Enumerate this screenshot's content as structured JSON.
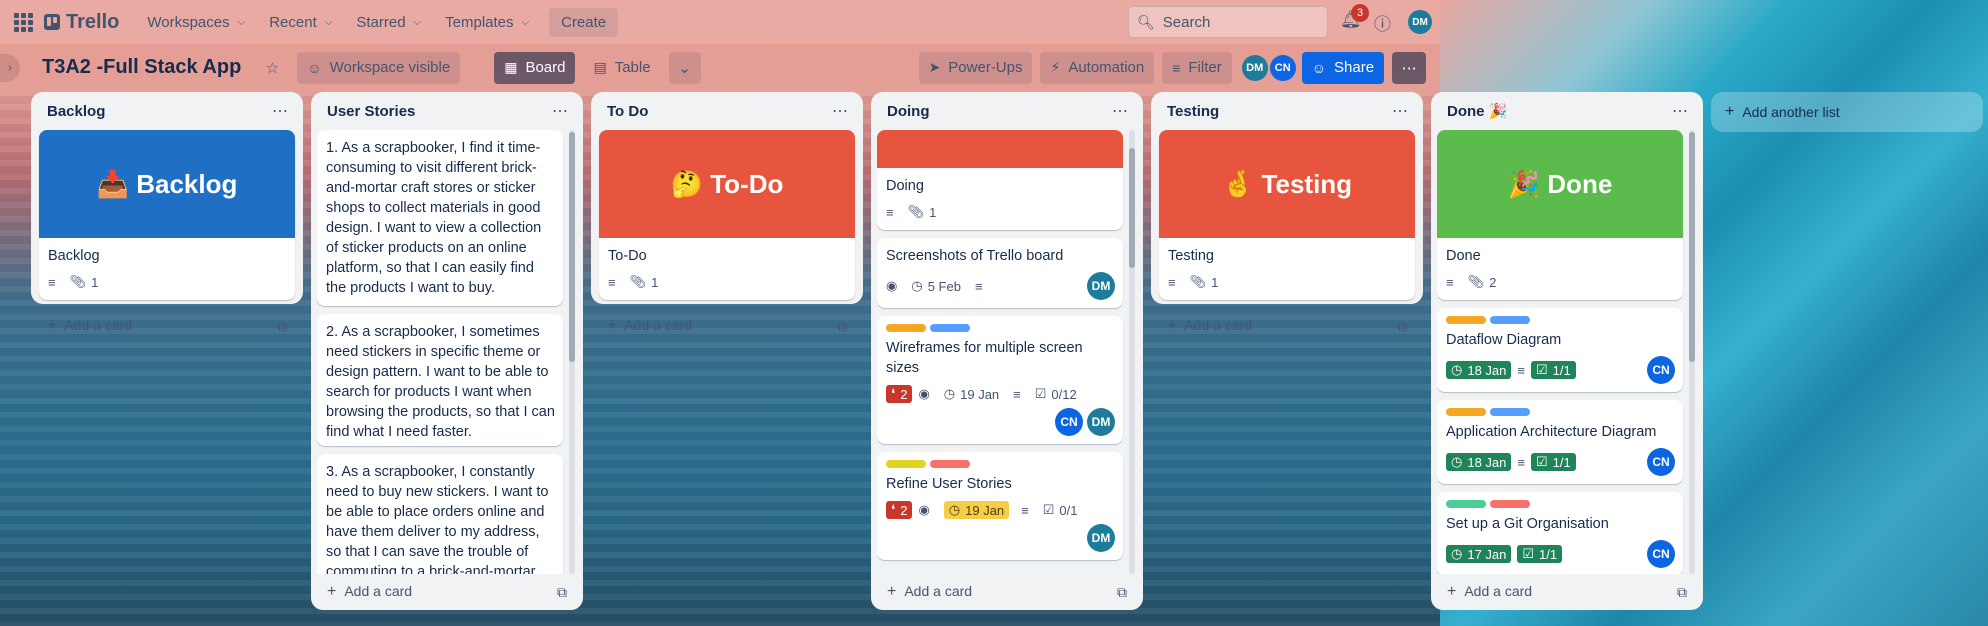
{
  "topnav": {
    "workspaces": "Workspaces",
    "recent": "Recent",
    "starred": "Starred",
    "templates": "Templates",
    "create": "Create",
    "search_placeholder": "Search",
    "notifications_count": "3",
    "avatar": "DM",
    "logo_text": "Trello"
  },
  "boardbar": {
    "title": "T3A2 -Full Stack App",
    "visibility": "Workspace visible",
    "board_view": "Board",
    "table_view": "Table",
    "powerups": "Power-Ups",
    "automation": "Automation",
    "filter": "Filter",
    "members": [
      "DM",
      "CN"
    ],
    "share": "Share"
  },
  "lists": {
    "backlog": {
      "title": "Backlog",
      "cover_text": "📥 Backlog",
      "cover_color": "#1f6fc5",
      "card_title": "Backlog",
      "attachments": "1",
      "add_card": "Add a card"
    },
    "user_stories": {
      "title": "User Stories",
      "stories": [
        "1. As a scrapbooker, I find it time-consuming to visit different brick-and-mortar craft stores or sticker shops to collect materials in good design. I want to view a collection of sticker products on an online platform, so that I can easily find the products I want to buy.",
        "2. As a scrapbooker, I sometimes need stickers in specific theme or design pattern. I want to be able to search for products I want when browsing the products, so that I can find what I need faster.",
        "3. As a scrapbooker, I constantly need to buy new stickers. I want to be able to place orders online and have them deliver to my address, so that I can save the trouble of commuting to a brick-and-mortar"
      ],
      "add_card": "Add a card"
    },
    "todo": {
      "title": "To Do",
      "cover_text": "🤔 To-Do",
      "cover_color": "#e8553f",
      "card_title": "To-Do",
      "attachments": "1",
      "add_card": "Add a card"
    },
    "doing": {
      "title": "Doing",
      "cover_color": "#e8553f",
      "cards": [
        {
          "title": "Doing",
          "attachments": "1"
        },
        {
          "title": "Screenshots of Trello board",
          "date": "5 Feb",
          "member": "DM"
        },
        {
          "title": "Wireframes for multiple screen sizes",
          "comments": "2",
          "date": "19 Jan",
          "checklist": "0/12",
          "members": [
            "CN",
            "DM"
          ],
          "labels": [
            "#f5a623",
            "#579dff"
          ]
        },
        {
          "title": "Refine User Stories",
          "comments": "2",
          "date": "19 Jan",
          "checklist": "0/1",
          "member": "DM",
          "labels": [
            "#e2d321",
            "#f87168"
          ]
        }
      ],
      "add_card": "Add a card"
    },
    "testing": {
      "title": "Testing",
      "cover_text": "🤞 Testing",
      "cover_color": "#e8553f",
      "card_title": "Testing",
      "attachments": "1",
      "add_card": "Add a card"
    },
    "done": {
      "title": "Done 🎉",
      "cover_text": "🎉 Done",
      "cover_color": "#5bbb4c",
      "card_title": "Done",
      "attachments": "2",
      "cards": [
        {
          "title": "Dataflow Diagram",
          "date": "18 Jan",
          "checklist": "1/1",
          "member": "CN",
          "labels": [
            "#f5a623",
            "#579dff"
          ]
        },
        {
          "title": "Application Architecture Diagram",
          "date": "18 Jan",
          "checklist": "1/1",
          "member": "CN",
          "labels": [
            "#f5a623",
            "#579dff"
          ]
        },
        {
          "title": "Set up a Git Organisation",
          "date": "17 Jan",
          "checklist": "1/1",
          "member": "CN",
          "labels": [
            "#4bce97",
            "#f87168"
          ]
        }
      ],
      "add_card": "Add a card"
    }
  },
  "add_another_list": "Add another list"
}
